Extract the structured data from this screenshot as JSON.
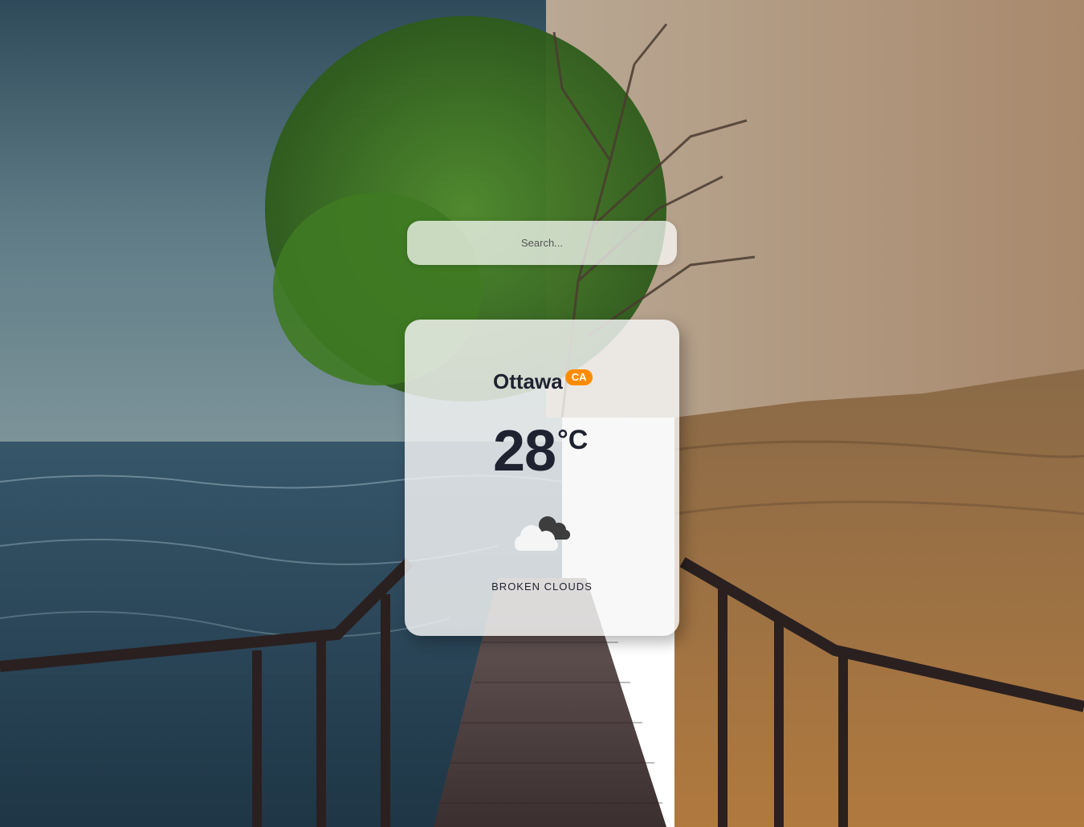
{
  "search": {
    "placeholder": "Search...",
    "value": ""
  },
  "weather": {
    "city": "Ottawa",
    "country": "CA",
    "temperature": "28",
    "unit": "°C",
    "description": "BROKEN CLOUDS",
    "icon": "broken-clouds-icon"
  },
  "colors": {
    "badge": "#ff8c00",
    "text": "#1f2230"
  }
}
